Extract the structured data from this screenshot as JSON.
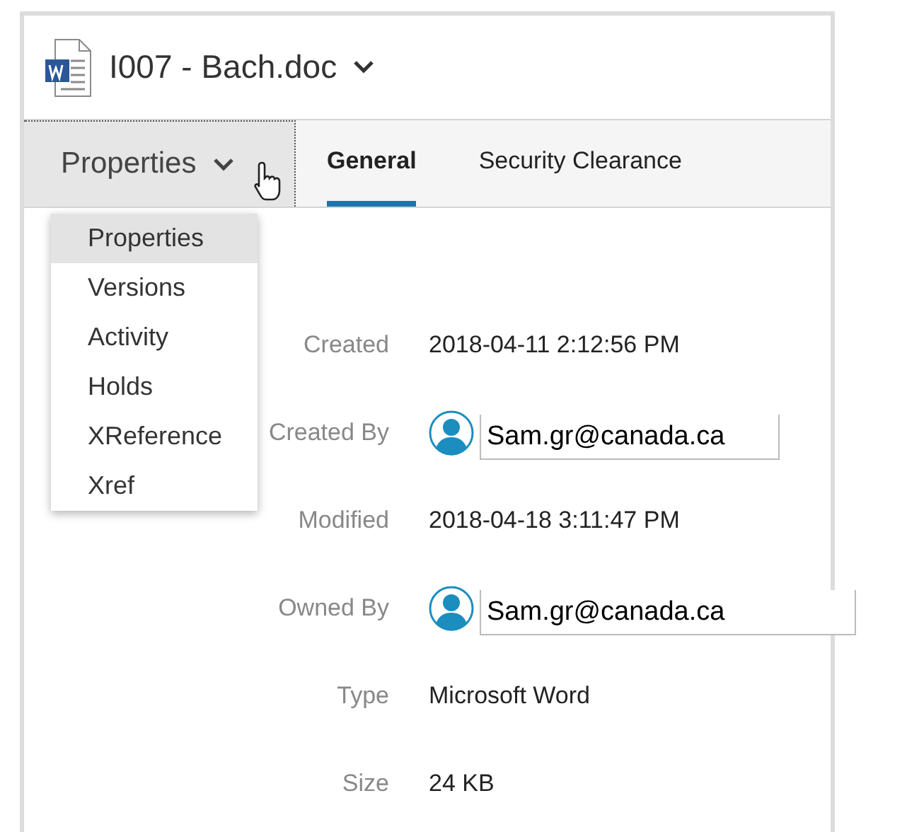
{
  "document": {
    "title": "I007 - Bach.doc"
  },
  "view_menu": {
    "label": "Properties",
    "expanded": true,
    "items": [
      {
        "label": "Properties",
        "selected": true
      },
      {
        "label": "Versions",
        "selected": false
      },
      {
        "label": "Activity",
        "selected": false
      },
      {
        "label": "Holds",
        "selected": false
      },
      {
        "label": "XReference",
        "selected": false
      },
      {
        "label": "Xref",
        "selected": false
      }
    ]
  },
  "tabs": [
    {
      "label": "General",
      "selected": true
    },
    {
      "label": "Security Clearance",
      "selected": false
    }
  ],
  "fields": [
    {
      "kind": "text",
      "label": "Created",
      "value": "2018-04-11 2:12:56 PM"
    },
    {
      "kind": "user",
      "label": "Created By",
      "value": "Sam.gr@canada.ca"
    },
    {
      "kind": "text",
      "label": "Modified",
      "value": "2018-04-18 3:11:47 PM"
    },
    {
      "kind": "user",
      "label": "Owned By",
      "value": "Sam.gr@canada.ca"
    },
    {
      "kind": "text",
      "label": "Type",
      "value": "Microsoft Word"
    },
    {
      "kind": "text",
      "label": "Size",
      "value": "24 KB"
    }
  ]
}
